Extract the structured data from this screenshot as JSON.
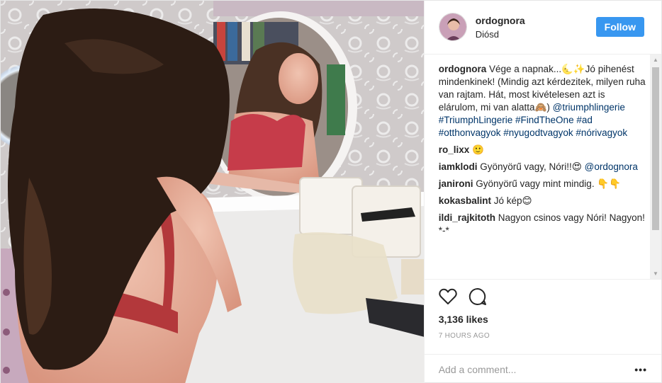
{
  "header": {
    "username": "ordognora",
    "location": "Diósd",
    "follow_label": "Follow"
  },
  "caption": {
    "author": "ordognora",
    "text": "Vége a napnak...🌜✨Jó pihenést mindenkinek! (Mindig azt kérdezitek, milyen ruha van rajtam. Hát, most kivételesen azt is elárulom, mi van alatta🙈)",
    "mention": "@triumphlingerie",
    "hashtags": "#TriumphLingerie #FindTheOne #ad #otthonvagyok #nyugodtvagyok #nórivagyok"
  },
  "comments": [
    {
      "author": "ro_lixx",
      "text": "🙂"
    },
    {
      "author": "iamklodi",
      "text": "Gyönyörű vagy, Nóri!!😍",
      "mention": "@ordognora"
    },
    {
      "author": "janironi",
      "text": "Gyönyörű vagy mint mindig. 👇👇"
    },
    {
      "author": "kokasbalint",
      "text": "Jó kép😊"
    },
    {
      "author": "ildi_rajkitoth",
      "text": "Nagyon csinos vagy Nóri! Nagyon! *-*"
    }
  ],
  "actions": {
    "likes": "3,136 likes",
    "time": "7 HOURS AGO"
  },
  "add_comment": {
    "placeholder": "Add a comment...",
    "more_label": "•••"
  },
  "icons": {
    "like": "heart-icon",
    "comment": "comment-bubble-icon",
    "more": "more-options-icon"
  },
  "colors": {
    "follow_button": "#3897f0",
    "tag_link": "#003569"
  }
}
